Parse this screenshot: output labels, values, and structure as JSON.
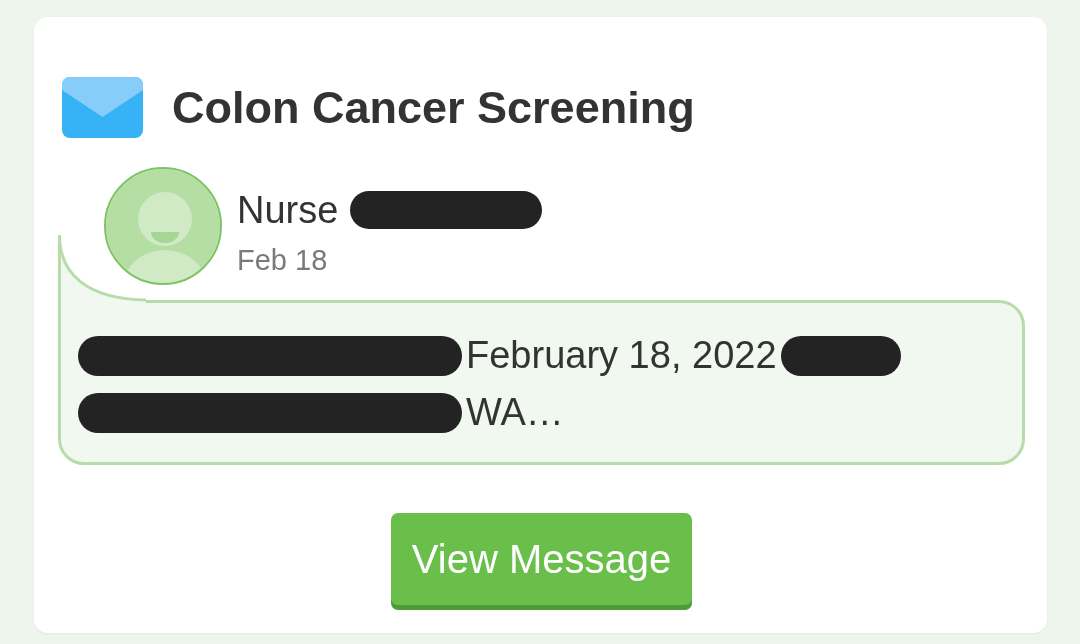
{
  "card": {
    "title": "Colon Cancer Screening",
    "message": {
      "sender": [
        {
          "kind": "text",
          "text": "Nurse"
        },
        {
          "kind": "redaction"
        }
      ],
      "date": "Feb 18",
      "preview_lines": [
        {
          "segments": [
            {
              "kind": "redaction"
            },
            {
              "kind": "text",
              "text": "February 18, 2022"
            },
            {
              "kind": "redaction"
            }
          ]
        },
        {
          "segments": [
            {
              "kind": "redaction"
            },
            {
              "kind": "text",
              "text": "WA…"
            }
          ]
        }
      ]
    },
    "button": "View Message"
  }
}
